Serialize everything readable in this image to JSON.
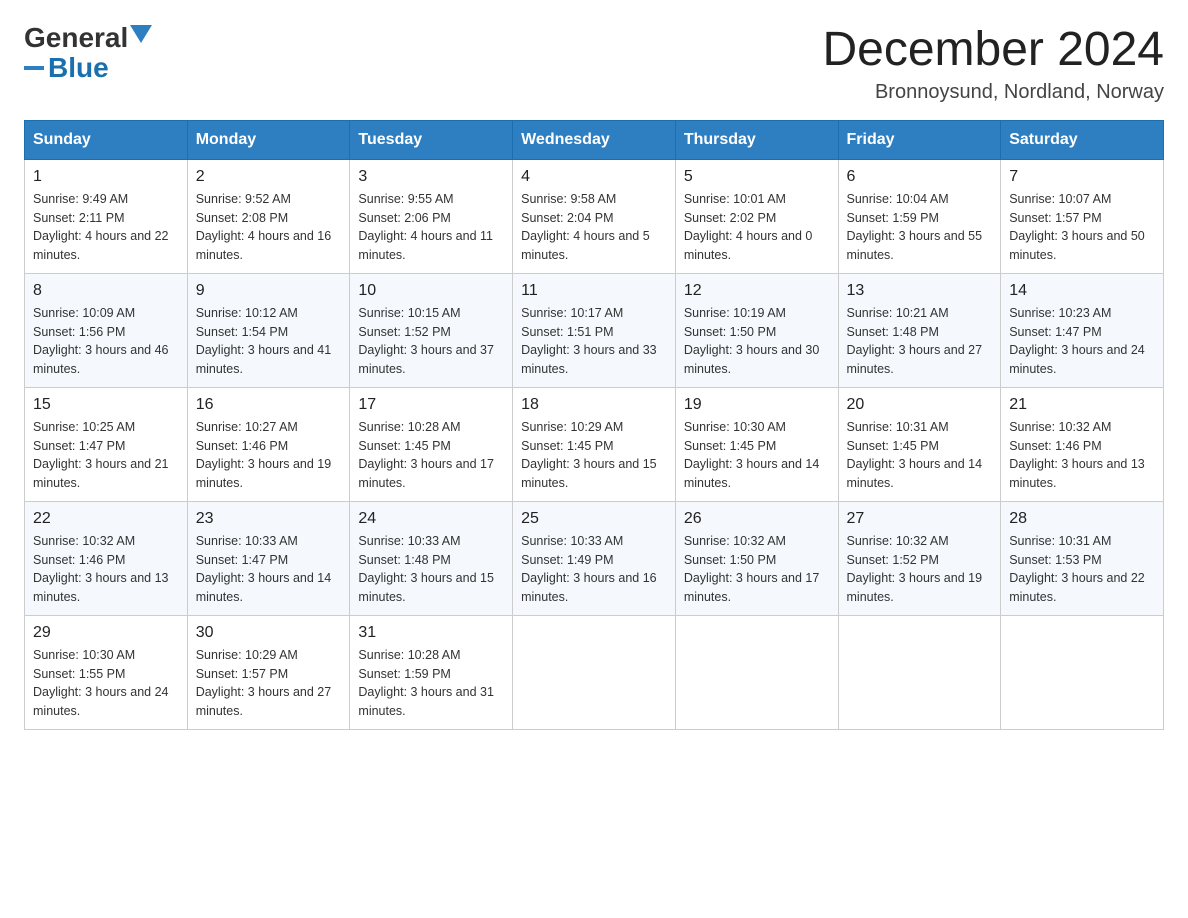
{
  "header": {
    "logo_general": "General",
    "logo_blue": "Blue",
    "title": "December 2024",
    "location": "Bronnoysund, Nordland, Norway"
  },
  "weekdays": [
    "Sunday",
    "Monday",
    "Tuesday",
    "Wednesday",
    "Thursday",
    "Friday",
    "Saturday"
  ],
  "weeks": [
    [
      {
        "day": "1",
        "sunrise": "9:49 AM",
        "sunset": "2:11 PM",
        "daylight": "4 hours and 22 minutes."
      },
      {
        "day": "2",
        "sunrise": "9:52 AM",
        "sunset": "2:08 PM",
        "daylight": "4 hours and 16 minutes."
      },
      {
        "day": "3",
        "sunrise": "9:55 AM",
        "sunset": "2:06 PM",
        "daylight": "4 hours and 11 minutes."
      },
      {
        "day": "4",
        "sunrise": "9:58 AM",
        "sunset": "2:04 PM",
        "daylight": "4 hours and 5 minutes."
      },
      {
        "day": "5",
        "sunrise": "10:01 AM",
        "sunset": "2:02 PM",
        "daylight": "4 hours and 0 minutes."
      },
      {
        "day": "6",
        "sunrise": "10:04 AM",
        "sunset": "1:59 PM",
        "daylight": "3 hours and 55 minutes."
      },
      {
        "day": "7",
        "sunrise": "10:07 AM",
        "sunset": "1:57 PM",
        "daylight": "3 hours and 50 minutes."
      }
    ],
    [
      {
        "day": "8",
        "sunrise": "10:09 AM",
        "sunset": "1:56 PM",
        "daylight": "3 hours and 46 minutes."
      },
      {
        "day": "9",
        "sunrise": "10:12 AM",
        "sunset": "1:54 PM",
        "daylight": "3 hours and 41 minutes."
      },
      {
        "day": "10",
        "sunrise": "10:15 AM",
        "sunset": "1:52 PM",
        "daylight": "3 hours and 37 minutes."
      },
      {
        "day": "11",
        "sunrise": "10:17 AM",
        "sunset": "1:51 PM",
        "daylight": "3 hours and 33 minutes."
      },
      {
        "day": "12",
        "sunrise": "10:19 AM",
        "sunset": "1:50 PM",
        "daylight": "3 hours and 30 minutes."
      },
      {
        "day": "13",
        "sunrise": "10:21 AM",
        "sunset": "1:48 PM",
        "daylight": "3 hours and 27 minutes."
      },
      {
        "day": "14",
        "sunrise": "10:23 AM",
        "sunset": "1:47 PM",
        "daylight": "3 hours and 24 minutes."
      }
    ],
    [
      {
        "day": "15",
        "sunrise": "10:25 AM",
        "sunset": "1:47 PM",
        "daylight": "3 hours and 21 minutes."
      },
      {
        "day": "16",
        "sunrise": "10:27 AM",
        "sunset": "1:46 PM",
        "daylight": "3 hours and 19 minutes."
      },
      {
        "day": "17",
        "sunrise": "10:28 AM",
        "sunset": "1:45 PM",
        "daylight": "3 hours and 17 minutes."
      },
      {
        "day": "18",
        "sunrise": "10:29 AM",
        "sunset": "1:45 PM",
        "daylight": "3 hours and 15 minutes."
      },
      {
        "day": "19",
        "sunrise": "10:30 AM",
        "sunset": "1:45 PM",
        "daylight": "3 hours and 14 minutes."
      },
      {
        "day": "20",
        "sunrise": "10:31 AM",
        "sunset": "1:45 PM",
        "daylight": "3 hours and 14 minutes."
      },
      {
        "day": "21",
        "sunrise": "10:32 AM",
        "sunset": "1:46 PM",
        "daylight": "3 hours and 13 minutes."
      }
    ],
    [
      {
        "day": "22",
        "sunrise": "10:32 AM",
        "sunset": "1:46 PM",
        "daylight": "3 hours and 13 minutes."
      },
      {
        "day": "23",
        "sunrise": "10:33 AM",
        "sunset": "1:47 PM",
        "daylight": "3 hours and 14 minutes."
      },
      {
        "day": "24",
        "sunrise": "10:33 AM",
        "sunset": "1:48 PM",
        "daylight": "3 hours and 15 minutes."
      },
      {
        "day": "25",
        "sunrise": "10:33 AM",
        "sunset": "1:49 PM",
        "daylight": "3 hours and 16 minutes."
      },
      {
        "day": "26",
        "sunrise": "10:32 AM",
        "sunset": "1:50 PM",
        "daylight": "3 hours and 17 minutes."
      },
      {
        "day": "27",
        "sunrise": "10:32 AM",
        "sunset": "1:52 PM",
        "daylight": "3 hours and 19 minutes."
      },
      {
        "day": "28",
        "sunrise": "10:31 AM",
        "sunset": "1:53 PM",
        "daylight": "3 hours and 22 minutes."
      }
    ],
    [
      {
        "day": "29",
        "sunrise": "10:30 AM",
        "sunset": "1:55 PM",
        "daylight": "3 hours and 24 minutes."
      },
      {
        "day": "30",
        "sunrise": "10:29 AM",
        "sunset": "1:57 PM",
        "daylight": "3 hours and 27 minutes."
      },
      {
        "day": "31",
        "sunrise": "10:28 AM",
        "sunset": "1:59 PM",
        "daylight": "3 hours and 31 minutes."
      },
      null,
      null,
      null,
      null
    ]
  ],
  "labels": {
    "sunrise": "Sunrise:",
    "sunset": "Sunset:",
    "daylight": "Daylight:"
  }
}
